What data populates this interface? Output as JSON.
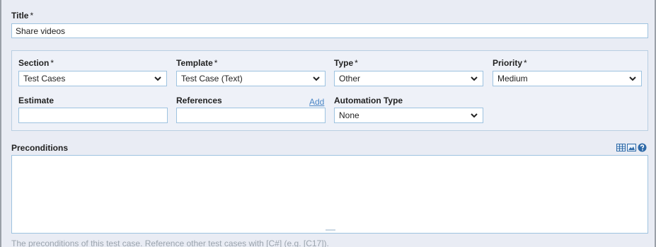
{
  "title_field": {
    "label": "Title",
    "required": "*",
    "value": "Share videos"
  },
  "fields": {
    "section": {
      "label": "Section",
      "required": "*",
      "value": "Test Cases"
    },
    "template": {
      "label": "Template",
      "required": "*",
      "value": "Test Case (Text)"
    },
    "type": {
      "label": "Type",
      "required": "*",
      "value": "Other"
    },
    "priority": {
      "label": "Priority",
      "required": "*",
      "value": "Medium"
    },
    "estimate": {
      "label": "Estimate",
      "value": ""
    },
    "references": {
      "label": "References",
      "value": "",
      "add_link": "Add"
    },
    "automation_type": {
      "label": "Automation Type",
      "value": "None"
    }
  },
  "preconditions": {
    "label": "Preconditions",
    "value": "",
    "hint": "The preconditions of this test case. Reference other test cases with [C#] (e.g. [C17]).",
    "tools": [
      "table-icon",
      "image-icon",
      "help-icon"
    ]
  },
  "colors": {
    "accent": "#4a86c5",
    "border": "#9ec3e0",
    "background": "#e9ecf4"
  }
}
